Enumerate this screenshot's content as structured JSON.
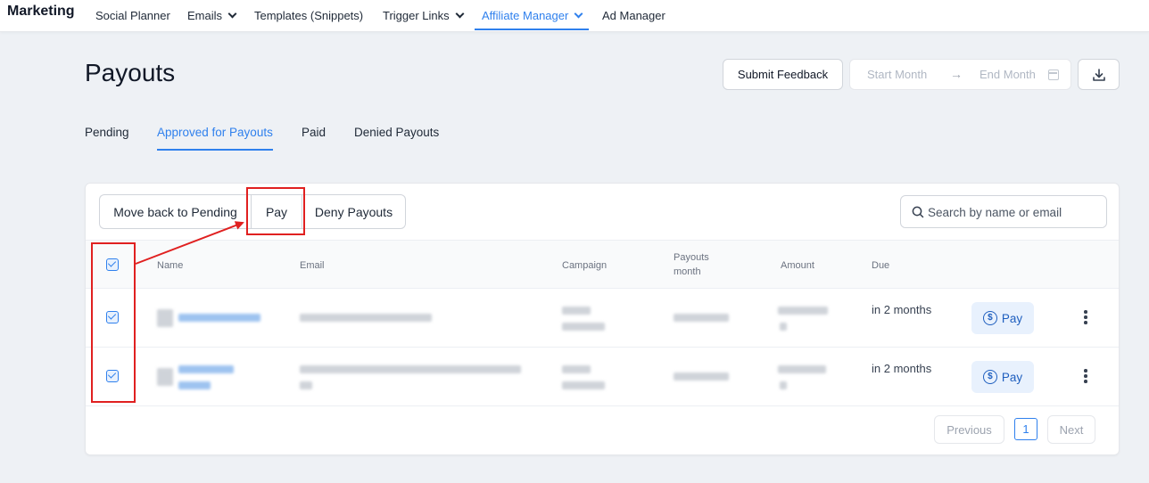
{
  "nav": {
    "brand": "Marketing",
    "items": [
      {
        "label": "Social Planner",
        "dropdown": false
      },
      {
        "label": "Emails",
        "dropdown": true
      },
      {
        "label": "Templates (Snippets)",
        "dropdown": false
      },
      {
        "label": "Trigger Links",
        "dropdown": true
      },
      {
        "label": "Affiliate Manager",
        "dropdown": true,
        "active": true
      },
      {
        "label": "Ad Manager",
        "dropdown": false
      }
    ]
  },
  "header": {
    "title": "Payouts",
    "feedback_label": "Submit Feedback",
    "start_placeholder": "Start Month",
    "end_placeholder": "End Month",
    "arrow": "→"
  },
  "tabs": [
    {
      "label": "Pending"
    },
    {
      "label": "Approved for Payouts",
      "active": true
    },
    {
      "label": "Paid"
    },
    {
      "label": "Denied Payouts"
    }
  ],
  "actions": {
    "move_label": "Move back to Pending",
    "pay_label": "Pay",
    "deny_label": "Deny Payouts",
    "search_placeholder": "Search by name or email"
  },
  "table": {
    "columns": [
      "Name",
      "Email",
      "Campaign",
      "Payouts month",
      "Amount",
      "Due"
    ],
    "rows": [
      {
        "selected": true,
        "due": "in 2 months",
        "pay_label": "Pay"
      },
      {
        "selected": true,
        "due": "in 2 months",
        "pay_label": "Pay"
      }
    ]
  },
  "pagination": {
    "prev_label": "Previous",
    "page": "1",
    "next_label": "Next"
  },
  "colors": {
    "accent": "#2f80ed",
    "annotation": "#e02020"
  }
}
